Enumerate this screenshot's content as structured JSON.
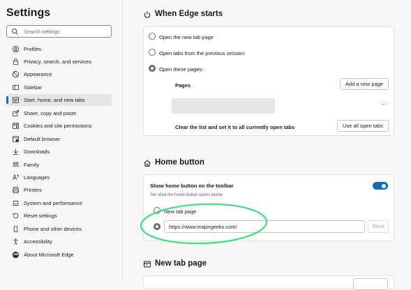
{
  "sidebar": {
    "title": "Settings",
    "search_placeholder": "Search settings",
    "items": [
      {
        "label": "Profiles"
      },
      {
        "label": "Privacy, search, and services"
      },
      {
        "label": "Appearance"
      },
      {
        "label": "Sidebar"
      },
      {
        "label": "Start, home, and new tabs"
      },
      {
        "label": "Share, copy and paste"
      },
      {
        "label": "Cookies and site permissions"
      },
      {
        "label": "Default browser"
      },
      {
        "label": "Downloads"
      },
      {
        "label": "Family"
      },
      {
        "label": "Languages"
      },
      {
        "label": "Printers"
      },
      {
        "label": "System and performance"
      },
      {
        "label": "Reset settings"
      },
      {
        "label": "Phone and other devices"
      },
      {
        "label": "Accessibility"
      },
      {
        "label": "About Microsoft Edge"
      }
    ]
  },
  "when_edge_starts": {
    "title": "When Edge starts",
    "option_new_tab": "Open the new tab page",
    "option_previous": "Open tabs from the previous session",
    "option_these_pages": "Open these pages:",
    "pages_label": "Pages",
    "add_page_button": "Add a new page",
    "more_label": "···",
    "clear_label": "Clear the list and set it to all currently open tabs",
    "use_all_button": "Use all open tabs"
  },
  "home_button": {
    "title": "Home button",
    "show_label": "Show home button on the toolbar",
    "sub_label": "Set what the home button opens below:",
    "option_new_tab": "New tab page",
    "url_value": "https://www.majorgeeks.com/",
    "save_button": "Save",
    "toggle_on": true
  },
  "new_tab_page": {
    "title": "New tab page"
  },
  "colors": {
    "accent": "#0f6cbd",
    "annotation": "#3ee07a"
  }
}
